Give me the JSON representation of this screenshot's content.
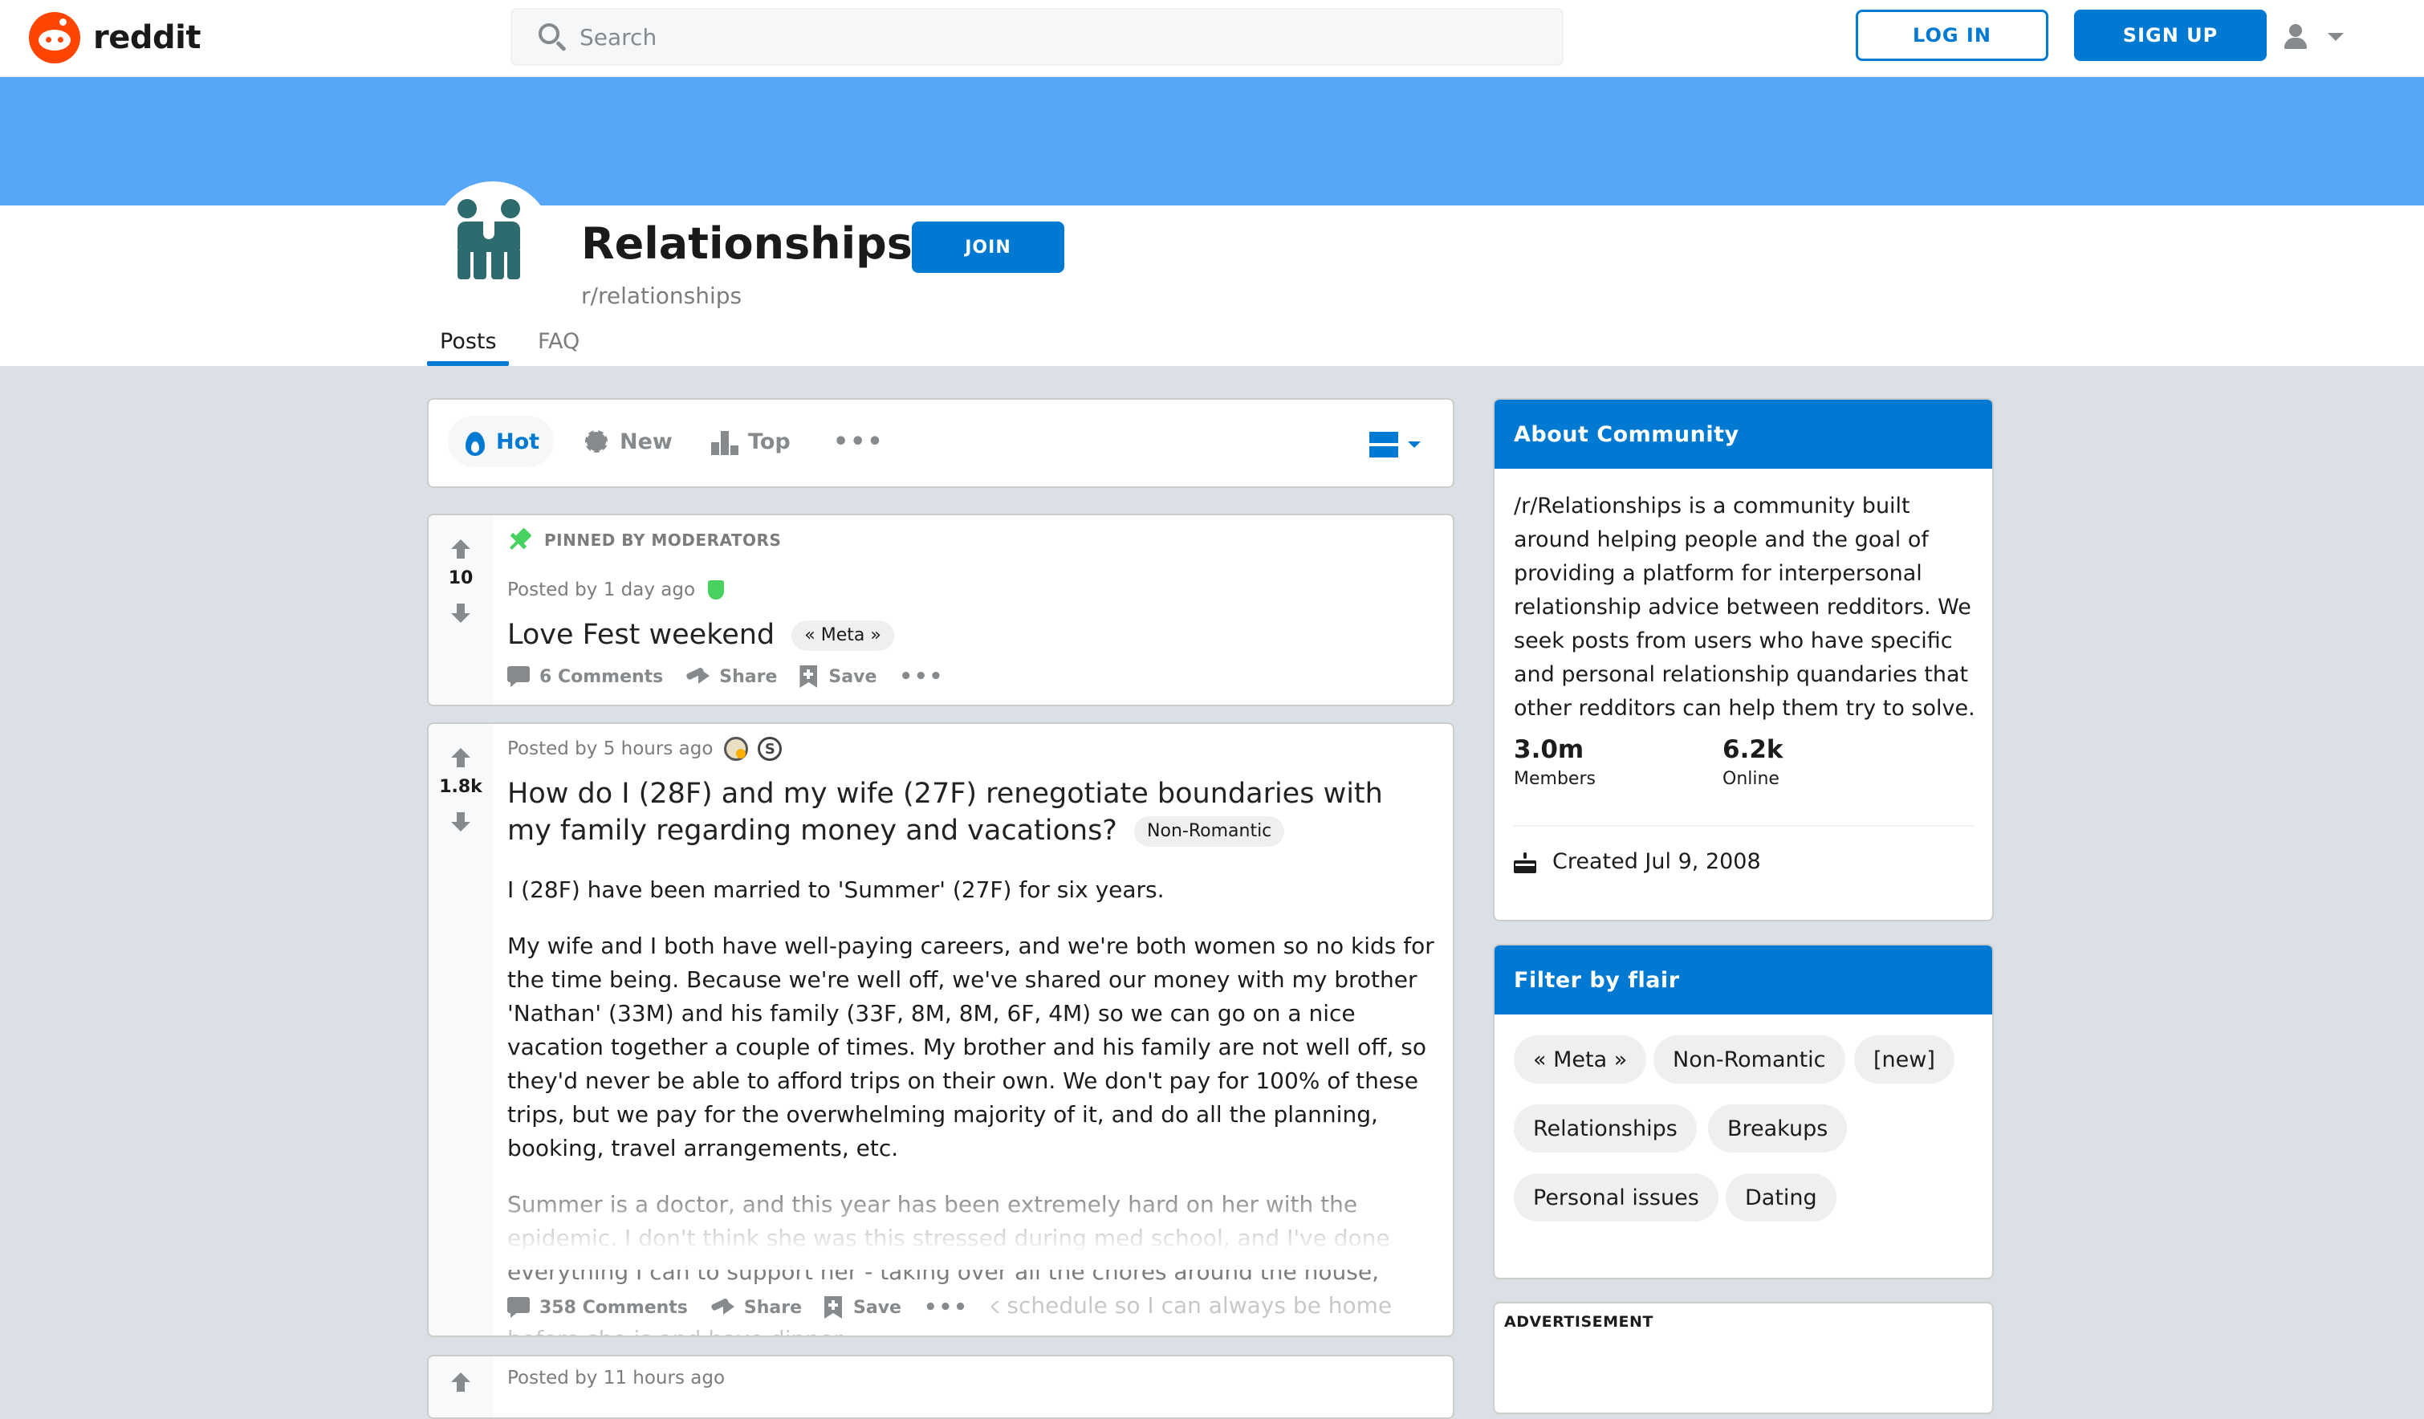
{
  "header": {
    "logo_text": "reddit",
    "search_placeholder": "Search",
    "login_label": "LOG IN",
    "signup_label": "SIGN UP"
  },
  "community": {
    "title": "Relationships",
    "subreddit": "r/relationships",
    "join_label": "JOIN",
    "tabs": [
      "Posts",
      "FAQ"
    ],
    "active_tab": "Posts",
    "banner_color": "#58a6f7",
    "accent_color": "#0079d3"
  },
  "sort": {
    "hot": "Hot",
    "new": "New",
    "top": "Top",
    "more": "•••"
  },
  "posts": [
    {
      "pinned_label": "PINNED BY MODERATORS",
      "votes": "10",
      "meta": "Posted by 1 day ago",
      "title": "Love Fest weekend",
      "flair": "« Meta »",
      "comments": "6 Comments",
      "share": "Share",
      "save": "Save"
    },
    {
      "votes": "1.8k",
      "meta": "Posted by 5 hours ago",
      "title": "How do I (28F) and my wife (27F) renegotiate boundaries with my family regarding money and vacations?",
      "flair": "Non-Romantic",
      "body": [
        "I (28F) have been married to 'Summer' (27F) for six years.",
        "My wife and I both have well-paying careers, and we're both women so no kids for the time being. Because we're well off, we've shared our money with my brother 'Nathan' (33M) and his family (33F, 8M, 8M, 6F, 4M) so we can go on a nice vacation together a couple of times. My brother and his family are not well off, so they'd never be able to afford trips on their own. We don't pay for 100% of these trips, but we pay for the overwhelming majority of it, and do all the planning, booking, travel arrangements, etc.",
        "Summer is a doctor, and this year has been extremely hard on her with the epidemic. I don't think she was this stressed during med school, and I've done everything I can to support her - taking over all the chores around the house, cooking every night,",
        "renegotiating my work schedule so I can always be home before she is and have dinner"
      ],
      "comments": "358 Comments",
      "share": "Share",
      "save": "Save"
    },
    {
      "meta": "Posted by 11 hours ago"
    }
  ],
  "sidebar": {
    "about_title": "About Community",
    "about_text": "/r/Relationships is a community built around helping people and the goal of providing a platform for interpersonal relationship advice between redditors. We seek posts from users who have specific and personal relationship quandaries that other redditors can help them try to solve.",
    "members_value": "3.0m",
    "members_label": "Members",
    "online_value": "6.2k",
    "online_label": "Online",
    "created": "Created Jul 9, 2008",
    "filter_title": "Filter by flair",
    "flairs": [
      "« Meta »",
      "Non-Romantic",
      "[new]",
      "Relationships",
      "Breakups",
      "Personal issues",
      "Dating"
    ],
    "ad_label": "ADVERTISEMENT"
  }
}
